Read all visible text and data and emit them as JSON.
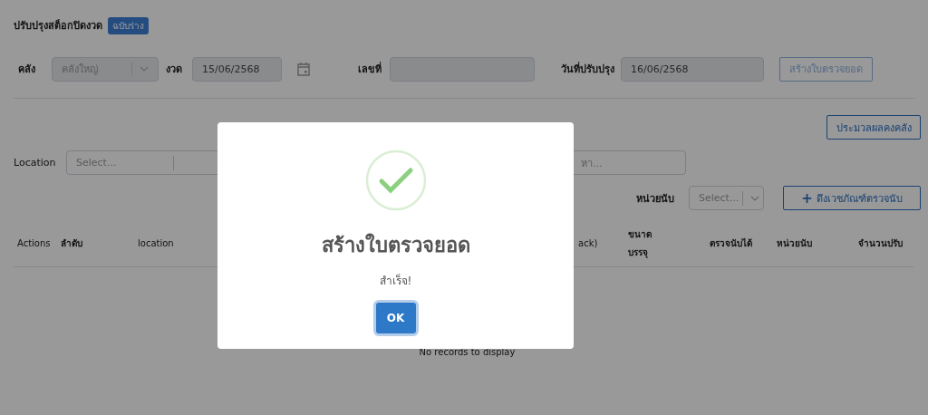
{
  "header": {
    "title": "ปรับปรุงสต็อกปิดงวด",
    "status_badge": "ฉบับร่าง"
  },
  "form": {
    "warehouse": {
      "label": "คลัง",
      "value": "คลังใหญ่",
      "disabled": true
    },
    "period": {
      "label": "งวด",
      "value": "15/06/2568",
      "disabled": true
    },
    "doc_no": {
      "label": "เลขที่",
      "disabled": true
    },
    "adjust_date": {
      "label": "วันที่ปรับปรุง",
      "value": "16/06/2568",
      "disabled": true
    },
    "create_button": {
      "label": "สร้างใบตรวจยอด",
      "disabled": true
    }
  },
  "process_button": "ประมวลผลคงคลัง",
  "location_filter": {
    "label": "Location",
    "placeholder": "Select..."
  },
  "search": {
    "placeholder": "หา..."
  },
  "unit_filter": {
    "label": "หน่วยนับ",
    "placeholder": "Select..."
  },
  "fetch_button": {
    "icon": "+",
    "label": "ดึงเวชภัณฑ์ตรวจนับ"
  },
  "table": {
    "columns": [
      "Actions",
      "ลำดับ",
      "location",
      "ack)",
      "ขนาด บรรจุ",
      "ตรวจนับได้",
      "หน่วยนับ",
      "จำนวนปรับ"
    ],
    "empty_text": "No records to display"
  },
  "dialog": {
    "title": "สร้างใบตรวจยอด",
    "message": "สำเร็จ!",
    "button": "OK"
  }
}
